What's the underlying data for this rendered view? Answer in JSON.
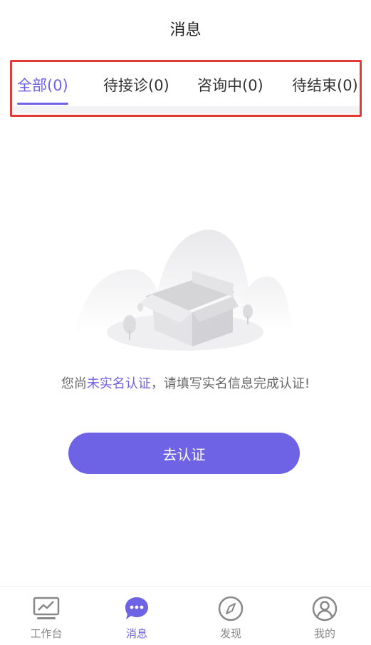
{
  "header": {
    "title": "消息"
  },
  "tabs": [
    {
      "label": "全部(0)",
      "active": true
    },
    {
      "label": "待接诊(0)",
      "active": false
    },
    {
      "label": "咨询中(0)",
      "active": false
    },
    {
      "label": "待结束(0)",
      "active": false
    }
  ],
  "empty_state": {
    "illustration": "empty-box-illustration",
    "message_prefix": "您尚",
    "message_highlight": "未实名认证",
    "message_suffix": "，请填写实名信息完成认证!"
  },
  "verify_button": {
    "label": "去认证"
  },
  "bottom_nav": [
    {
      "label": "工作台",
      "icon": "monitor-chart-icon",
      "active": false
    },
    {
      "label": "消息",
      "icon": "chat-bubble-icon",
      "active": true
    },
    {
      "label": "发现",
      "icon": "compass-icon",
      "active": false
    },
    {
      "label": "我的",
      "icon": "user-icon",
      "active": false
    }
  ],
  "colors": {
    "accent": "#6e62e5",
    "highlight_border": "#e53935"
  }
}
